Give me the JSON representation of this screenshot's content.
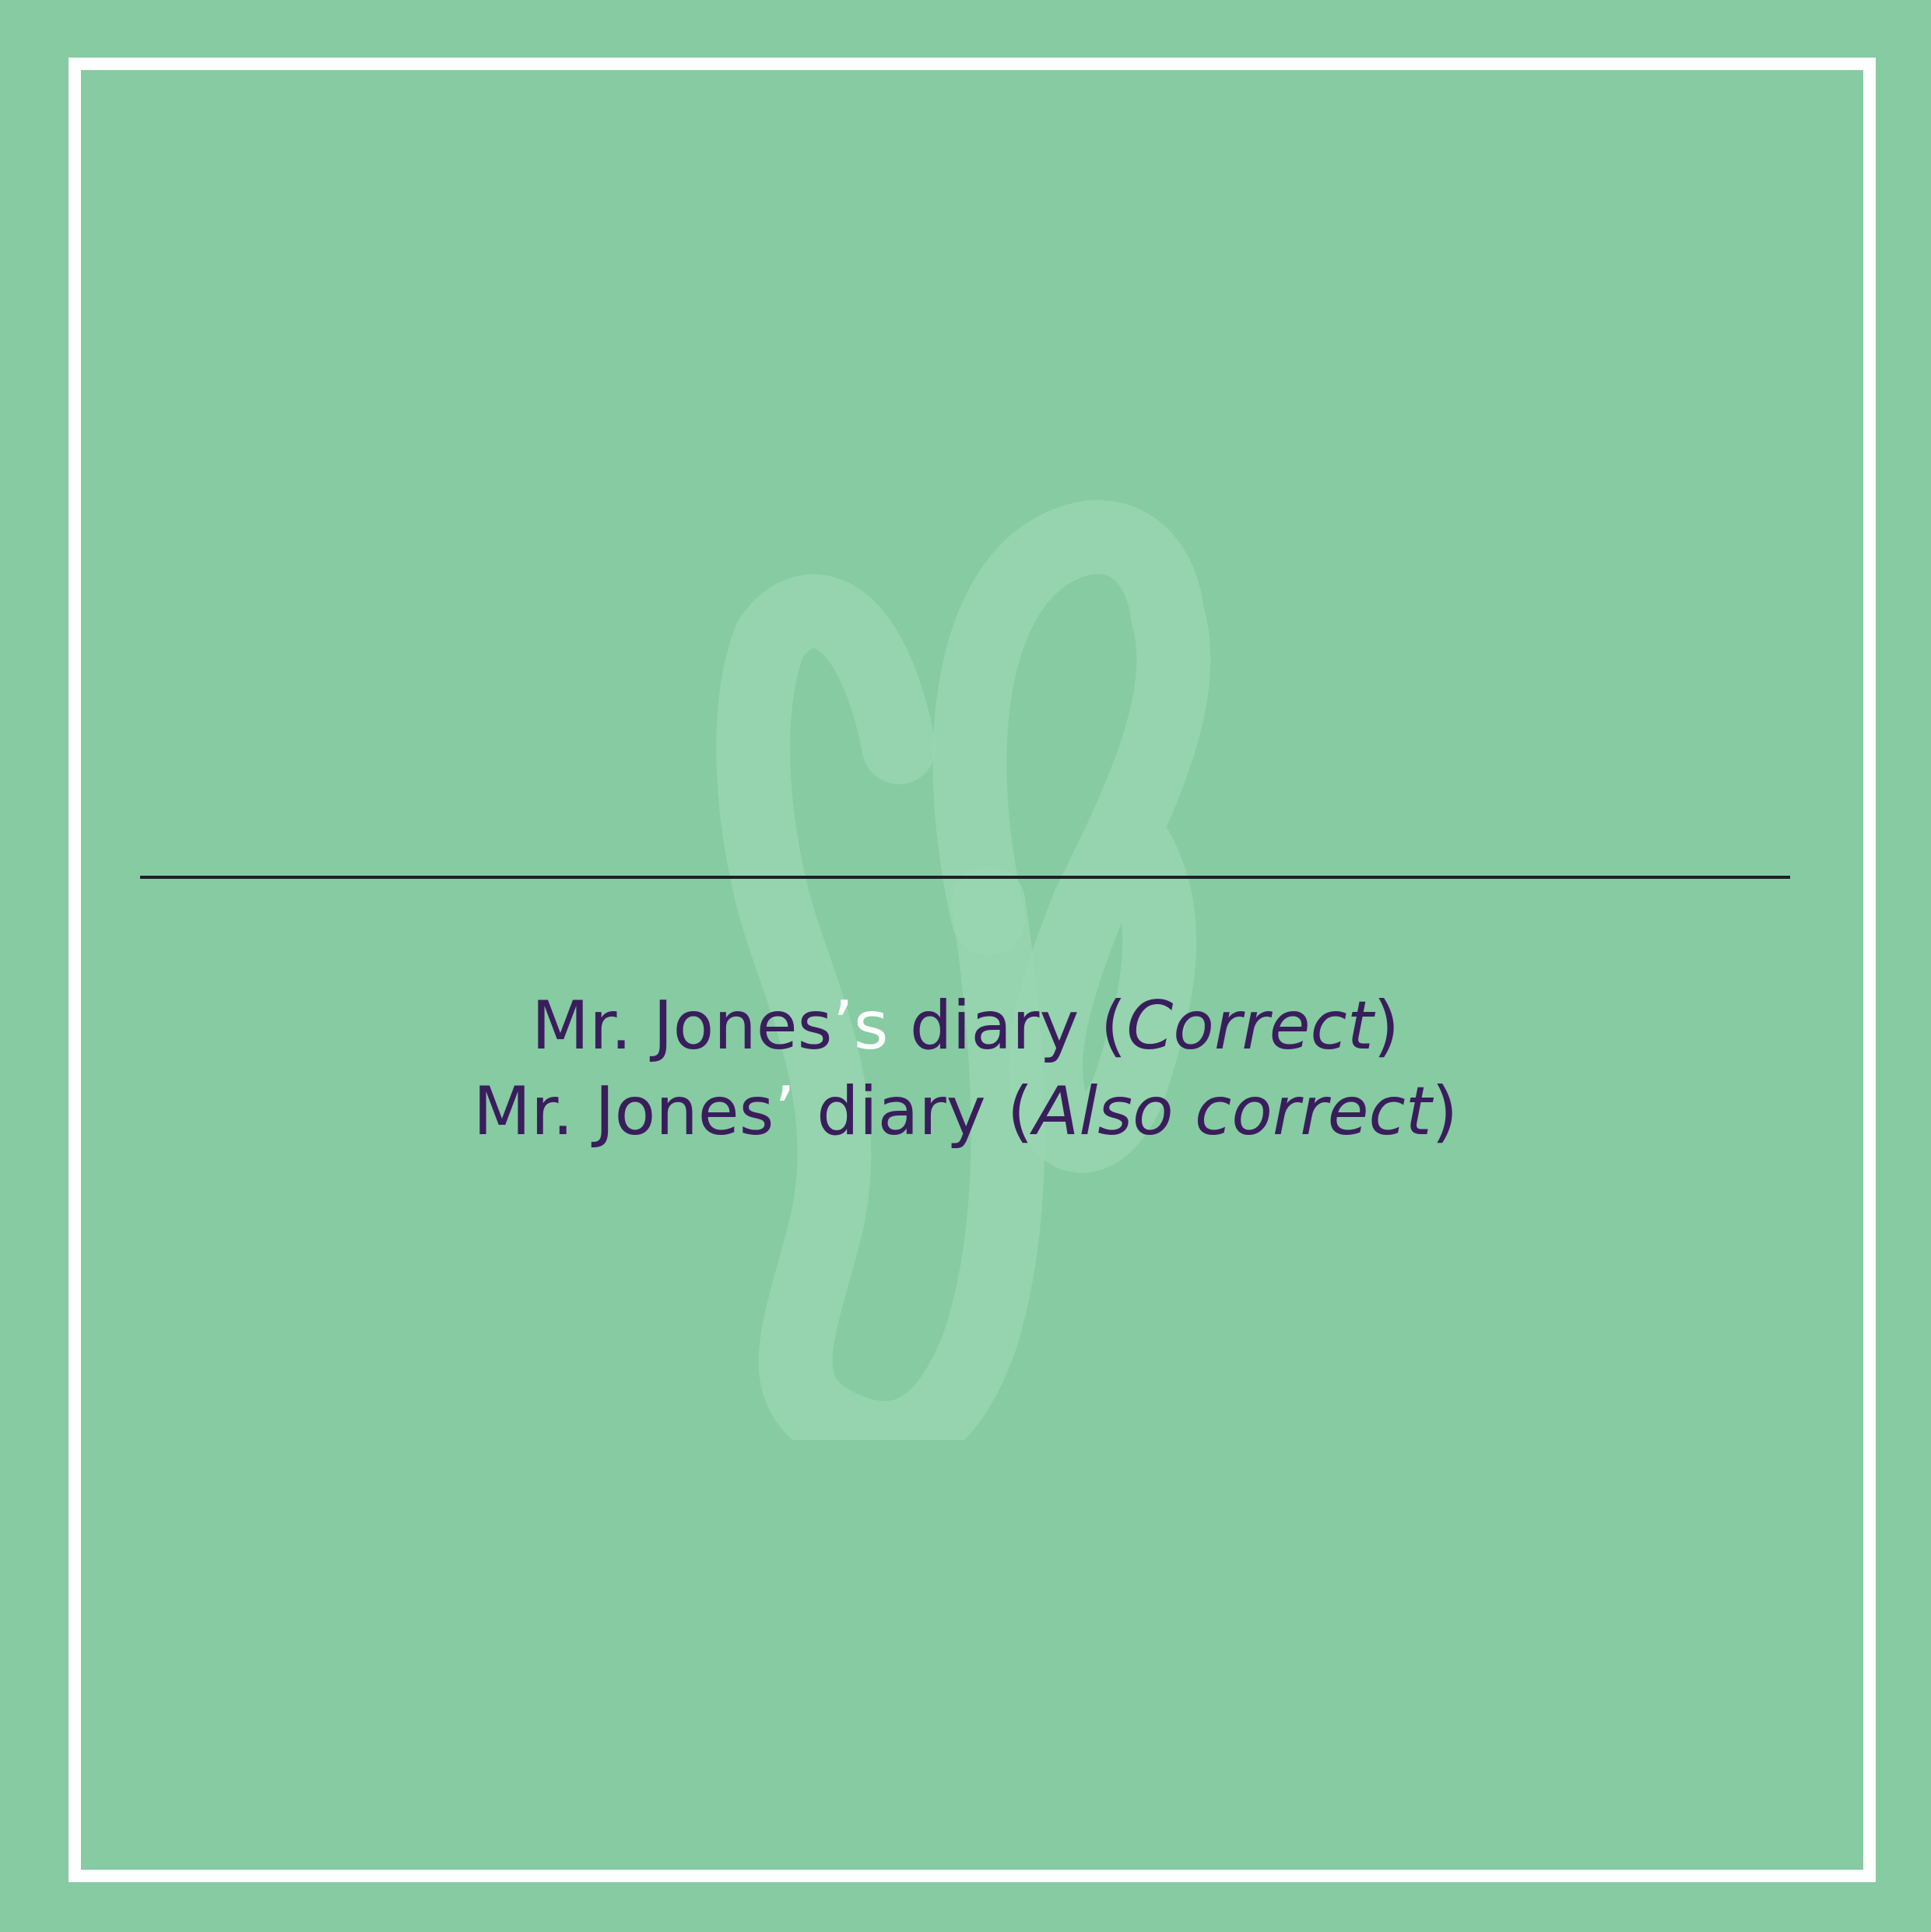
{
  "watermark": {
    "icon": "logo-monogram-icon",
    "color": "#a8dcb9"
  },
  "colors": {
    "background": "#86cba2",
    "frame": "#ffffff",
    "text": "#3a1d5c",
    "highlight": "#ffffff",
    "divider": "#1f1f2a"
  },
  "examples": [
    {
      "before_highlight": "Mr. Jones",
      "highlight": "’s",
      "after_highlight": " diary (",
      "italic": "Correct",
      "closing": ")"
    },
    {
      "before_highlight": "Mr. Jones",
      "highlight": "’",
      "after_highlight": " diary (",
      "italic": "Also correct",
      "closing": ")"
    }
  ]
}
